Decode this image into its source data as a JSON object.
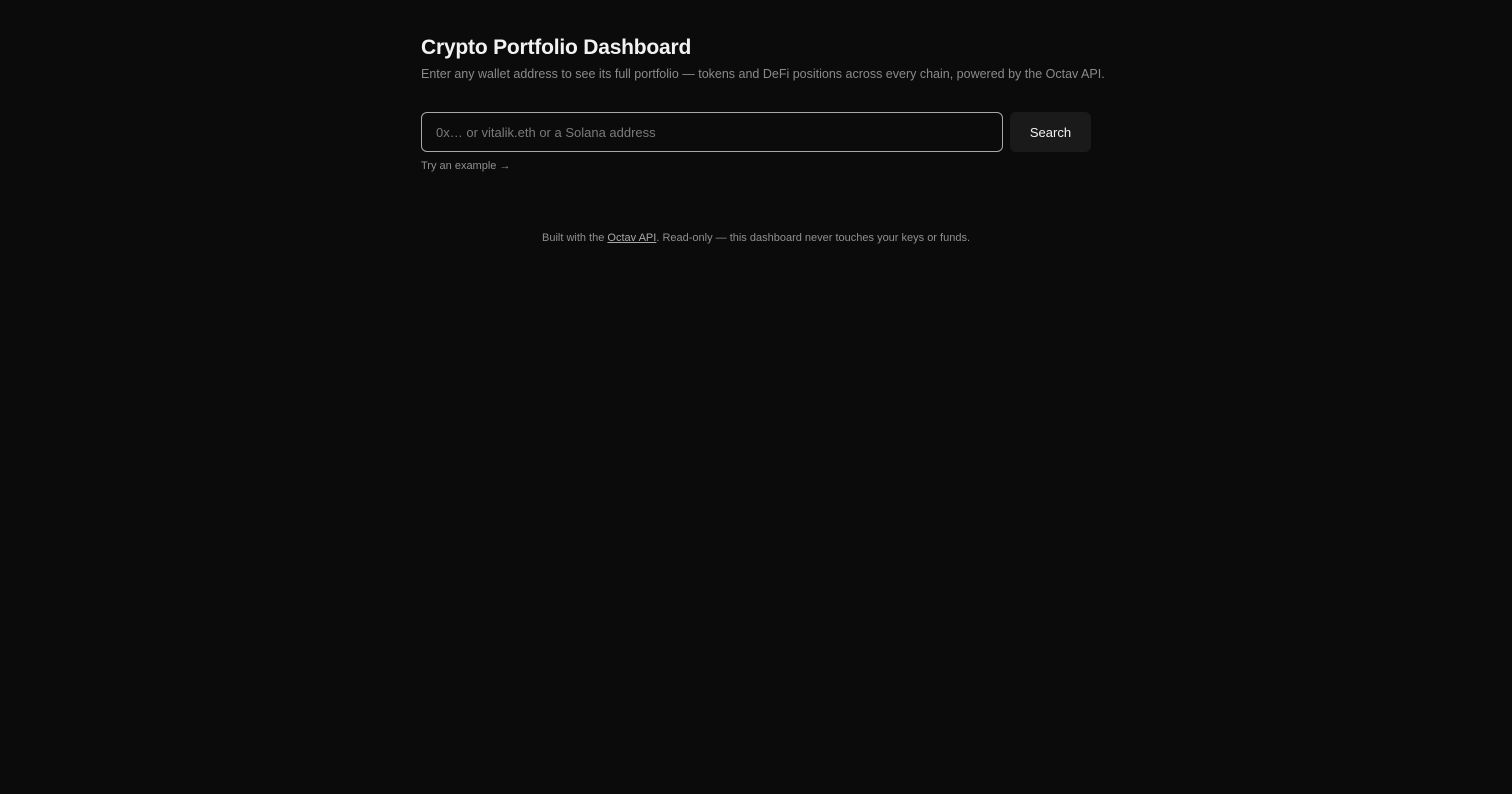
{
  "header": {
    "title": "Crypto Portfolio Dashboard",
    "subtitle": "Enter any wallet address to see its full portfolio — tokens and DeFi positions across every chain, powered by the Octav API."
  },
  "search": {
    "placeholder": "0x… or vitalik.eth or a Solana address",
    "value": "",
    "button_label": "Search"
  },
  "example": {
    "label": "Try an example →"
  },
  "footer": {
    "prefix": "Built with the ",
    "link_label": "Octav API",
    "suffix": ". Read-only — this dashboard never touches your keys or funds."
  }
}
